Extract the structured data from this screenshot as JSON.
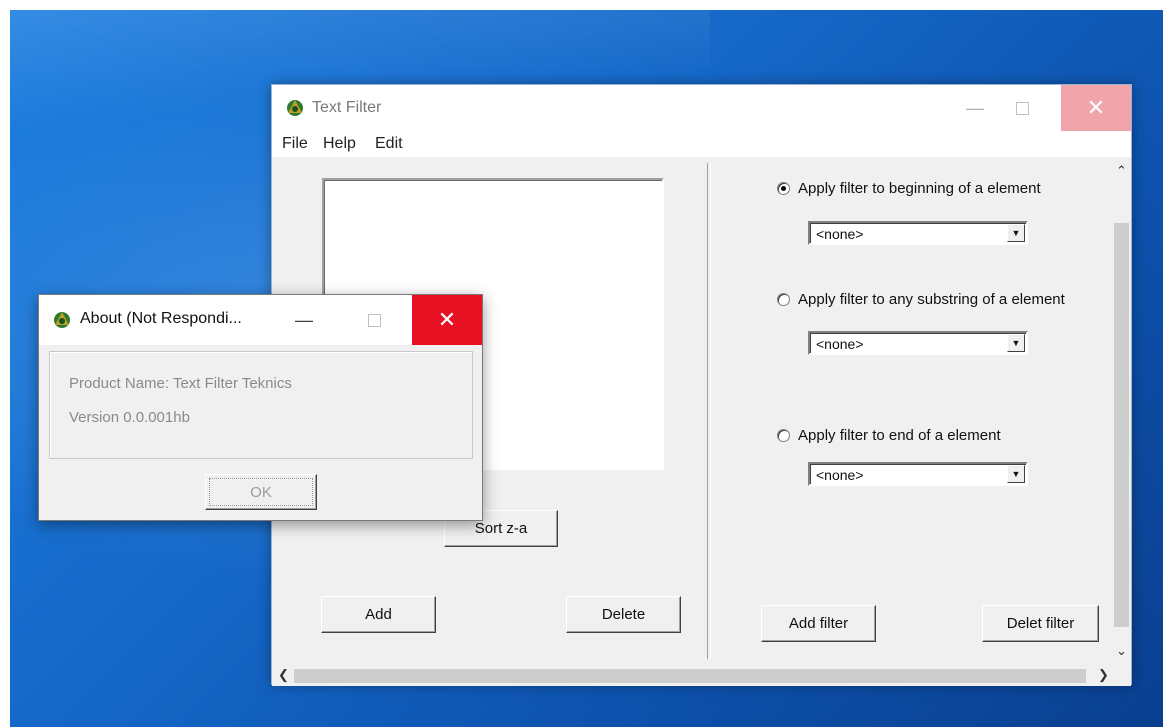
{
  "main_window": {
    "title": "Text Filter",
    "menu": [
      "File",
      "Help",
      "Edit"
    ],
    "buttons": {
      "sort": "Sort z-a",
      "add": "Add",
      "delete": "Delete",
      "add_filter": "Add filter",
      "delete_filter": "Delet filter"
    },
    "options": [
      {
        "label": "Apply filter to beginning of a element",
        "checked": true,
        "value": "<none>"
      },
      {
        "label": "Apply filter to any substring of a element",
        "checked": false,
        "value": "<none>"
      },
      {
        "label": "Apply filter to end of a element",
        "checked": false,
        "value": "<none>"
      }
    ]
  },
  "about_dialog": {
    "title": "About (Not Respondi...",
    "product_name": "Product Name:  Text Filter  Teknics",
    "version": "Version 0.0.001hb",
    "ok_label": "OK"
  },
  "colors": {
    "desktop": "#1568c8",
    "close_active": "#e81123",
    "close_inactive": "#f1a5ab"
  }
}
